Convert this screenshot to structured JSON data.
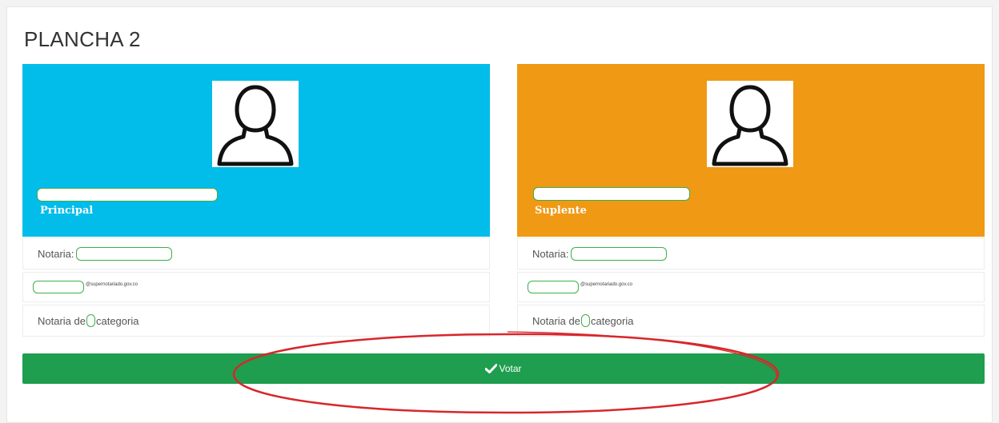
{
  "page": {
    "title": "PLANCHA 2"
  },
  "theme": {
    "principal_color": "#02bdea",
    "suplente_color": "#f09914",
    "vote_button_color": "#1e9e4e",
    "annotation_color": "#d8262b",
    "mask_border_color": "#3fae4a"
  },
  "candidates": [
    {
      "role": "Principal",
      "avatar_icon": "user-silhouette-icon",
      "notaria_label": "Notaria:",
      "email_domain": "@supernotariado.gov.co",
      "category_prefix": "Notaria de",
      "category_suffix": "categoria"
    },
    {
      "role": "Suplente",
      "avatar_icon": "user-silhouette-icon",
      "notaria_label": "Notaria:",
      "email_domain": "@supernotariado.gov.co",
      "category_prefix": "Notaria de",
      "category_suffix": "categoria"
    }
  ],
  "vote_button": {
    "label": "Votar",
    "icon": "check-icon"
  }
}
